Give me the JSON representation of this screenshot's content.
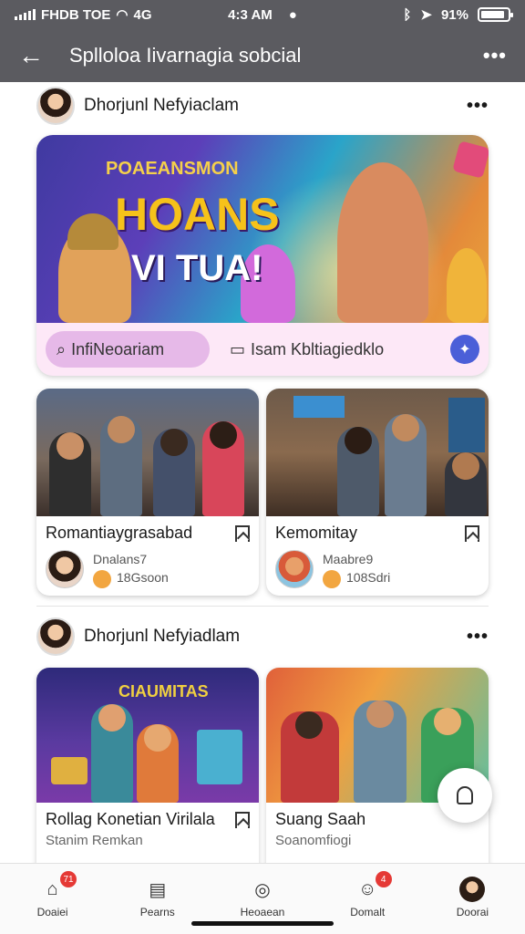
{
  "status_bar": {
    "carrier": "FHDB TOE",
    "network": "4G",
    "time": "4:3 AM",
    "battery_percent": "91%",
    "battery_level": 0.91
  },
  "app_bar": {
    "title": "Splloloa Iivarnagia sobcial"
  },
  "post1": {
    "author": "Dhorjunl Nefyiaclam",
    "banner": {
      "kicker": "POAEANSMON",
      "headline": "HOANS",
      "subheadline": "VI TUA!",
      "primary_action": "InfiNeoariam",
      "secondary_action": "Isam Kbltiagiedklo"
    },
    "cards": [
      {
        "title": "Romantiaygrasabad",
        "author_line": "Dnalans7",
        "stat_line": "18Gsoon"
      },
      {
        "title": "Kemomitay",
        "author_line": "Maabre9",
        "stat_line": "108Sdri"
      }
    ]
  },
  "post2": {
    "author": "Dhorjunl Nefyiadlam",
    "cards": [
      {
        "title": "Rollag Konetian Virilala",
        "subtitle": "Stanim Remkan",
        "banner_text": "CIAUMITAS"
      },
      {
        "title": "Suang Saah",
        "subtitle": "Soanomfiogi"
      }
    ]
  },
  "tab_bar": {
    "tabs": [
      {
        "label": "Doaiei",
        "badge": "71"
      },
      {
        "label": "Pearns",
        "badge": ""
      },
      {
        "label": "Heoaean",
        "badge": ""
      },
      {
        "label": "Domalt",
        "badge": "4"
      },
      {
        "label": "Doorai",
        "badge": ""
      }
    ]
  }
}
